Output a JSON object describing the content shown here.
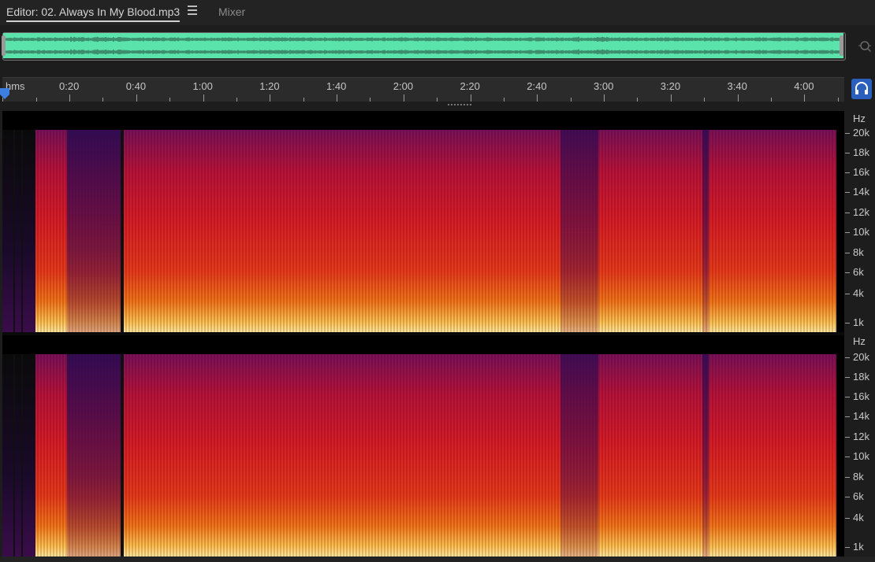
{
  "tabs": {
    "editor_label": "Editor: 02. Always In My Blood.mp3",
    "mixer_label": "Mixer"
  },
  "ruler": {
    "unit_label": "hms",
    "time_labels": [
      "0:20",
      "0:40",
      "1:00",
      "1:20",
      "1:40",
      "2:00",
      "2:20",
      "2:40",
      "3:00",
      "3:20",
      "3:40",
      "4:00"
    ]
  },
  "frequency_axis": {
    "unit": "Hz",
    "labels": [
      "20k",
      "18k",
      "16k",
      "14k",
      "12k",
      "10k",
      "8k",
      "6k",
      "4k",
      "1k"
    ]
  },
  "icons": {
    "tab_menu": "hamburger-icon",
    "zoom": "zoom-magnifier-icon",
    "headphones": "headphones-icon",
    "playhead": "playhead-marker-icon"
  },
  "colors": {
    "overview_waveform": "#5be3ac",
    "headphones_button": "#2a5fbd",
    "playhead": "#3d7fe0",
    "spectrogram_hot": "#ffe79a",
    "spectrogram_mid": "#d81d26",
    "spectrogram_cool": "#7a1158"
  }
}
